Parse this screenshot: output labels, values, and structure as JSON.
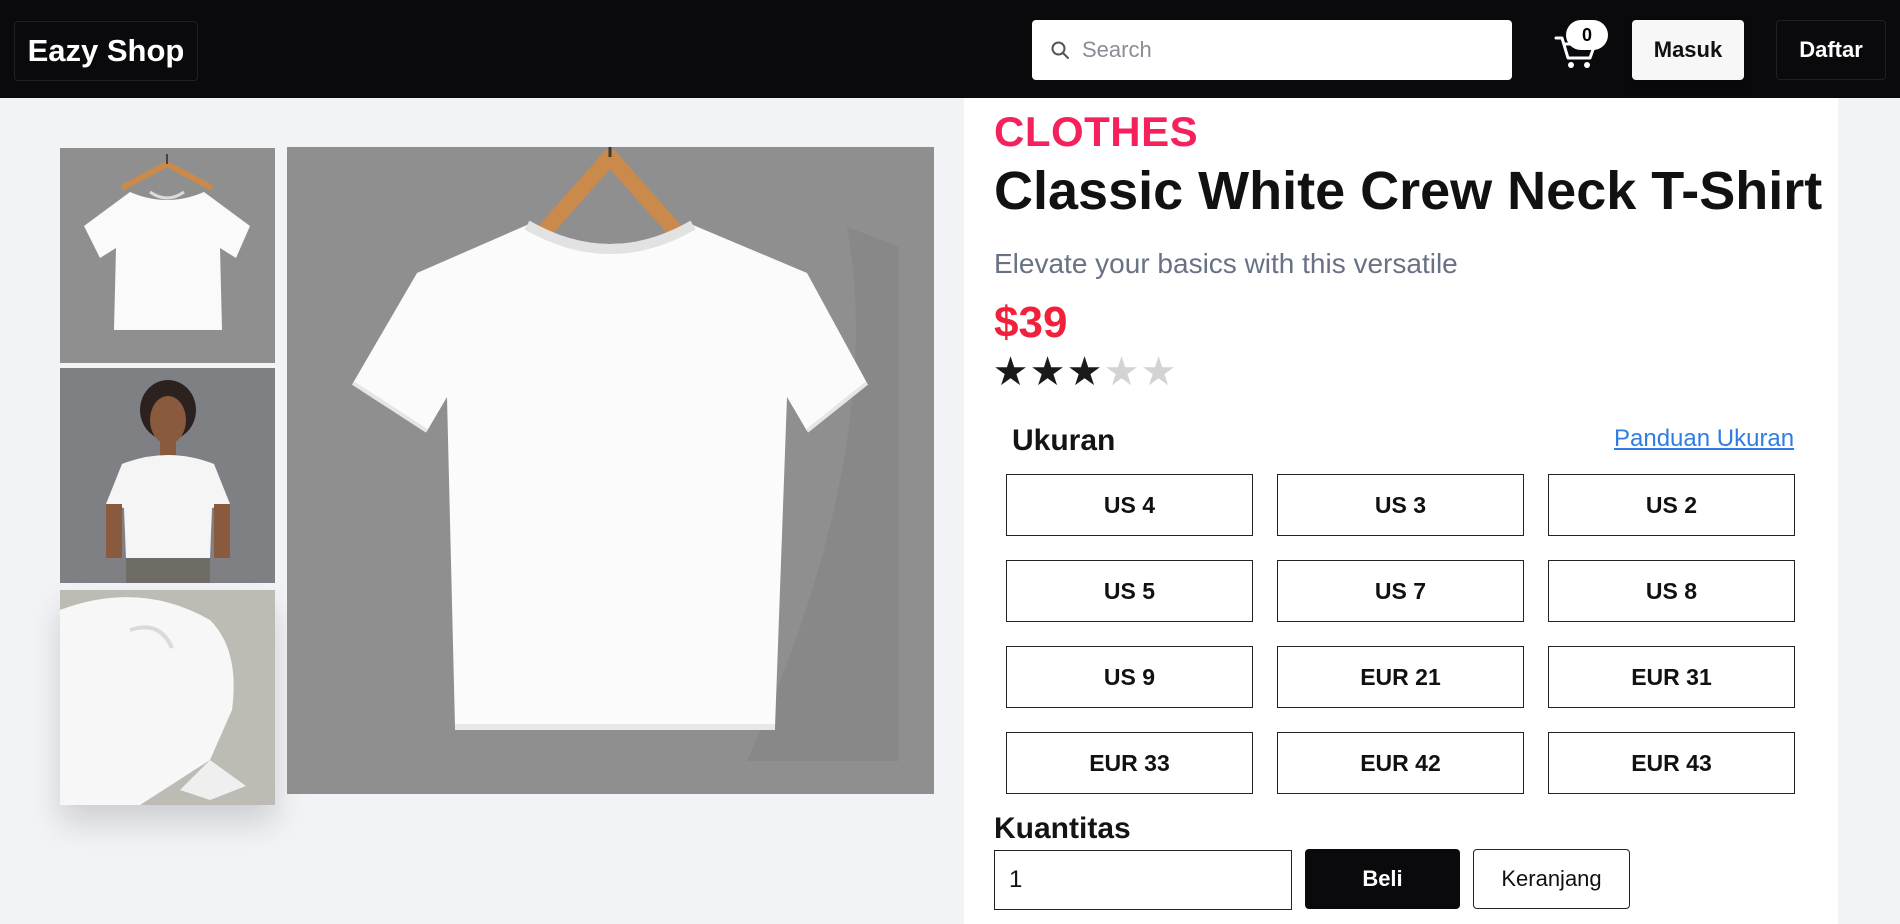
{
  "header": {
    "brand": "Eazy Shop",
    "search_placeholder": "Search",
    "cart_count": "0",
    "login_label": "Masuk",
    "register_label": "Daftar"
  },
  "product": {
    "category": "CLOTHES",
    "name": "Classic White Crew Neck T-Shirt",
    "description": "Elevate your basics with this versatile",
    "price": "$39",
    "rating": 3,
    "rating_max": 5,
    "size_label": "Ukuran",
    "size_guide_label": "Panduan Ukuran",
    "sizes": [
      "US 4",
      "US 3",
      "US 2",
      "US 5",
      "US 7",
      "US 8",
      "US 9",
      "EUR 21",
      "EUR 31",
      "EUR 33",
      "EUR 42",
      "EUR 43"
    ],
    "quantity_label": "Kuantitas",
    "quantity_value": "1",
    "buy_label": "Beli",
    "add_to_cart_label": "Keranjang"
  },
  "icons": {
    "search": "search-icon",
    "cart": "cart-icon",
    "star": "star-icon"
  },
  "colors": {
    "header_bg": "#0a0a0c",
    "category": "#f5215d",
    "price": "#f2213b",
    "link": "#2f7de3",
    "page_bg": "#f1f3f6"
  }
}
